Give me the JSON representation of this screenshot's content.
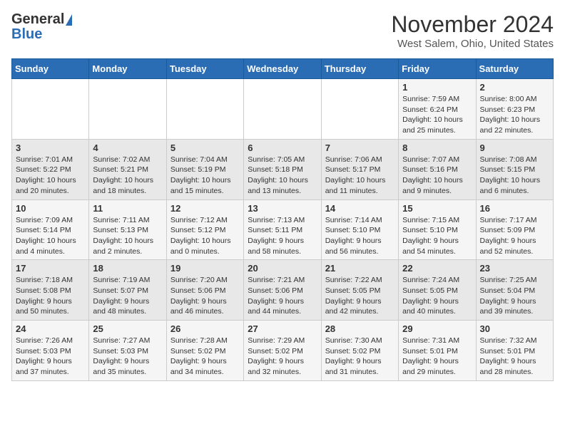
{
  "header": {
    "logo_general": "General",
    "logo_blue": "Blue",
    "month_year": "November 2024",
    "location": "West Salem, Ohio, United States"
  },
  "days_of_week": [
    "Sunday",
    "Monday",
    "Tuesday",
    "Wednesday",
    "Thursday",
    "Friday",
    "Saturday"
  ],
  "weeks": [
    [
      {
        "day": "",
        "info": ""
      },
      {
        "day": "",
        "info": ""
      },
      {
        "day": "",
        "info": ""
      },
      {
        "day": "",
        "info": ""
      },
      {
        "day": "",
        "info": ""
      },
      {
        "day": "1",
        "info": "Sunrise: 7:59 AM\nSunset: 6:24 PM\nDaylight: 10 hours and 25 minutes."
      },
      {
        "day": "2",
        "info": "Sunrise: 8:00 AM\nSunset: 6:23 PM\nDaylight: 10 hours and 22 minutes."
      }
    ],
    [
      {
        "day": "3",
        "info": "Sunrise: 7:01 AM\nSunset: 5:22 PM\nDaylight: 10 hours and 20 minutes."
      },
      {
        "day": "4",
        "info": "Sunrise: 7:02 AM\nSunset: 5:21 PM\nDaylight: 10 hours and 18 minutes."
      },
      {
        "day": "5",
        "info": "Sunrise: 7:04 AM\nSunset: 5:19 PM\nDaylight: 10 hours and 15 minutes."
      },
      {
        "day": "6",
        "info": "Sunrise: 7:05 AM\nSunset: 5:18 PM\nDaylight: 10 hours and 13 minutes."
      },
      {
        "day": "7",
        "info": "Sunrise: 7:06 AM\nSunset: 5:17 PM\nDaylight: 10 hours and 11 minutes."
      },
      {
        "day": "8",
        "info": "Sunrise: 7:07 AM\nSunset: 5:16 PM\nDaylight: 10 hours and 9 minutes."
      },
      {
        "day": "9",
        "info": "Sunrise: 7:08 AM\nSunset: 5:15 PM\nDaylight: 10 hours and 6 minutes."
      }
    ],
    [
      {
        "day": "10",
        "info": "Sunrise: 7:09 AM\nSunset: 5:14 PM\nDaylight: 10 hours and 4 minutes."
      },
      {
        "day": "11",
        "info": "Sunrise: 7:11 AM\nSunset: 5:13 PM\nDaylight: 10 hours and 2 minutes."
      },
      {
        "day": "12",
        "info": "Sunrise: 7:12 AM\nSunset: 5:12 PM\nDaylight: 10 hours and 0 minutes."
      },
      {
        "day": "13",
        "info": "Sunrise: 7:13 AM\nSunset: 5:11 PM\nDaylight: 9 hours and 58 minutes."
      },
      {
        "day": "14",
        "info": "Sunrise: 7:14 AM\nSunset: 5:10 PM\nDaylight: 9 hours and 56 minutes."
      },
      {
        "day": "15",
        "info": "Sunrise: 7:15 AM\nSunset: 5:10 PM\nDaylight: 9 hours and 54 minutes."
      },
      {
        "day": "16",
        "info": "Sunrise: 7:17 AM\nSunset: 5:09 PM\nDaylight: 9 hours and 52 minutes."
      }
    ],
    [
      {
        "day": "17",
        "info": "Sunrise: 7:18 AM\nSunset: 5:08 PM\nDaylight: 9 hours and 50 minutes."
      },
      {
        "day": "18",
        "info": "Sunrise: 7:19 AM\nSunset: 5:07 PM\nDaylight: 9 hours and 48 minutes."
      },
      {
        "day": "19",
        "info": "Sunrise: 7:20 AM\nSunset: 5:06 PM\nDaylight: 9 hours and 46 minutes."
      },
      {
        "day": "20",
        "info": "Sunrise: 7:21 AM\nSunset: 5:06 PM\nDaylight: 9 hours and 44 minutes."
      },
      {
        "day": "21",
        "info": "Sunrise: 7:22 AM\nSunset: 5:05 PM\nDaylight: 9 hours and 42 minutes."
      },
      {
        "day": "22",
        "info": "Sunrise: 7:24 AM\nSunset: 5:05 PM\nDaylight: 9 hours and 40 minutes."
      },
      {
        "day": "23",
        "info": "Sunrise: 7:25 AM\nSunset: 5:04 PM\nDaylight: 9 hours and 39 minutes."
      }
    ],
    [
      {
        "day": "24",
        "info": "Sunrise: 7:26 AM\nSunset: 5:03 PM\nDaylight: 9 hours and 37 minutes."
      },
      {
        "day": "25",
        "info": "Sunrise: 7:27 AM\nSunset: 5:03 PM\nDaylight: 9 hours and 35 minutes."
      },
      {
        "day": "26",
        "info": "Sunrise: 7:28 AM\nSunset: 5:02 PM\nDaylight: 9 hours and 34 minutes."
      },
      {
        "day": "27",
        "info": "Sunrise: 7:29 AM\nSunset: 5:02 PM\nDaylight: 9 hours and 32 minutes."
      },
      {
        "day": "28",
        "info": "Sunrise: 7:30 AM\nSunset: 5:02 PM\nDaylight: 9 hours and 31 minutes."
      },
      {
        "day": "29",
        "info": "Sunrise: 7:31 AM\nSunset: 5:01 PM\nDaylight: 9 hours and 29 minutes."
      },
      {
        "day": "30",
        "info": "Sunrise: 7:32 AM\nSunset: 5:01 PM\nDaylight: 9 hours and 28 minutes."
      }
    ]
  ]
}
